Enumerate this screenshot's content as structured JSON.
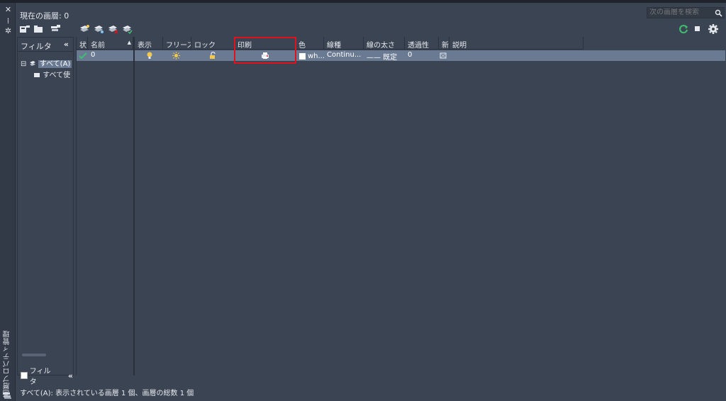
{
  "palette": {
    "title": "画層プロパティ管理",
    "close_glyph": "✕",
    "autohide_glyph": "⁞",
    "settings_glyph": "✲"
  },
  "header": {
    "current_layer": "現在の画層: 0",
    "search_placeholder": "次の画層を検索"
  },
  "filter_panel": {
    "title": "フィルタ",
    "collapse": "«",
    "tree": [
      {
        "label": "すべて(A)",
        "expand": "⊟"
      },
      {
        "label": "すべて使"
      }
    ],
    "invert_label": "フィルタ",
    "invert_collapse": "«"
  },
  "grid": {
    "columns": [
      {
        "key": "status",
        "label": "状"
      },
      {
        "key": "name",
        "label": "名前"
      },
      {
        "key": "on",
        "label": "表示"
      },
      {
        "key": "freeze",
        "label": "フリーズ"
      },
      {
        "key": "lock",
        "label": "ロック"
      },
      {
        "key": "plot",
        "label": "印刷"
      },
      {
        "key": "color",
        "label": "色"
      },
      {
        "key": "linetype",
        "label": "線種"
      },
      {
        "key": "lineweight",
        "label": "線の太さ"
      },
      {
        "key": "transparency",
        "label": "透過性"
      },
      {
        "key": "new",
        "label": "新"
      },
      {
        "key": "description",
        "label": "説明"
      }
    ],
    "sort_glyph": "▲",
    "rows": [
      {
        "status_icon": "check-icon",
        "name": "0",
        "color": "wh...",
        "linetype": "Continu...",
        "lineweight": "—— 既定",
        "transparency": "0"
      }
    ]
  },
  "status_bar": "すべて(A): 表示されている画層 1 個、画層の総数 1 個",
  "colors": {
    "background": "#3b4453",
    "selection": "#6b7a93",
    "highlight": "#e0121e",
    "accent_green": "#3fbf6f"
  }
}
